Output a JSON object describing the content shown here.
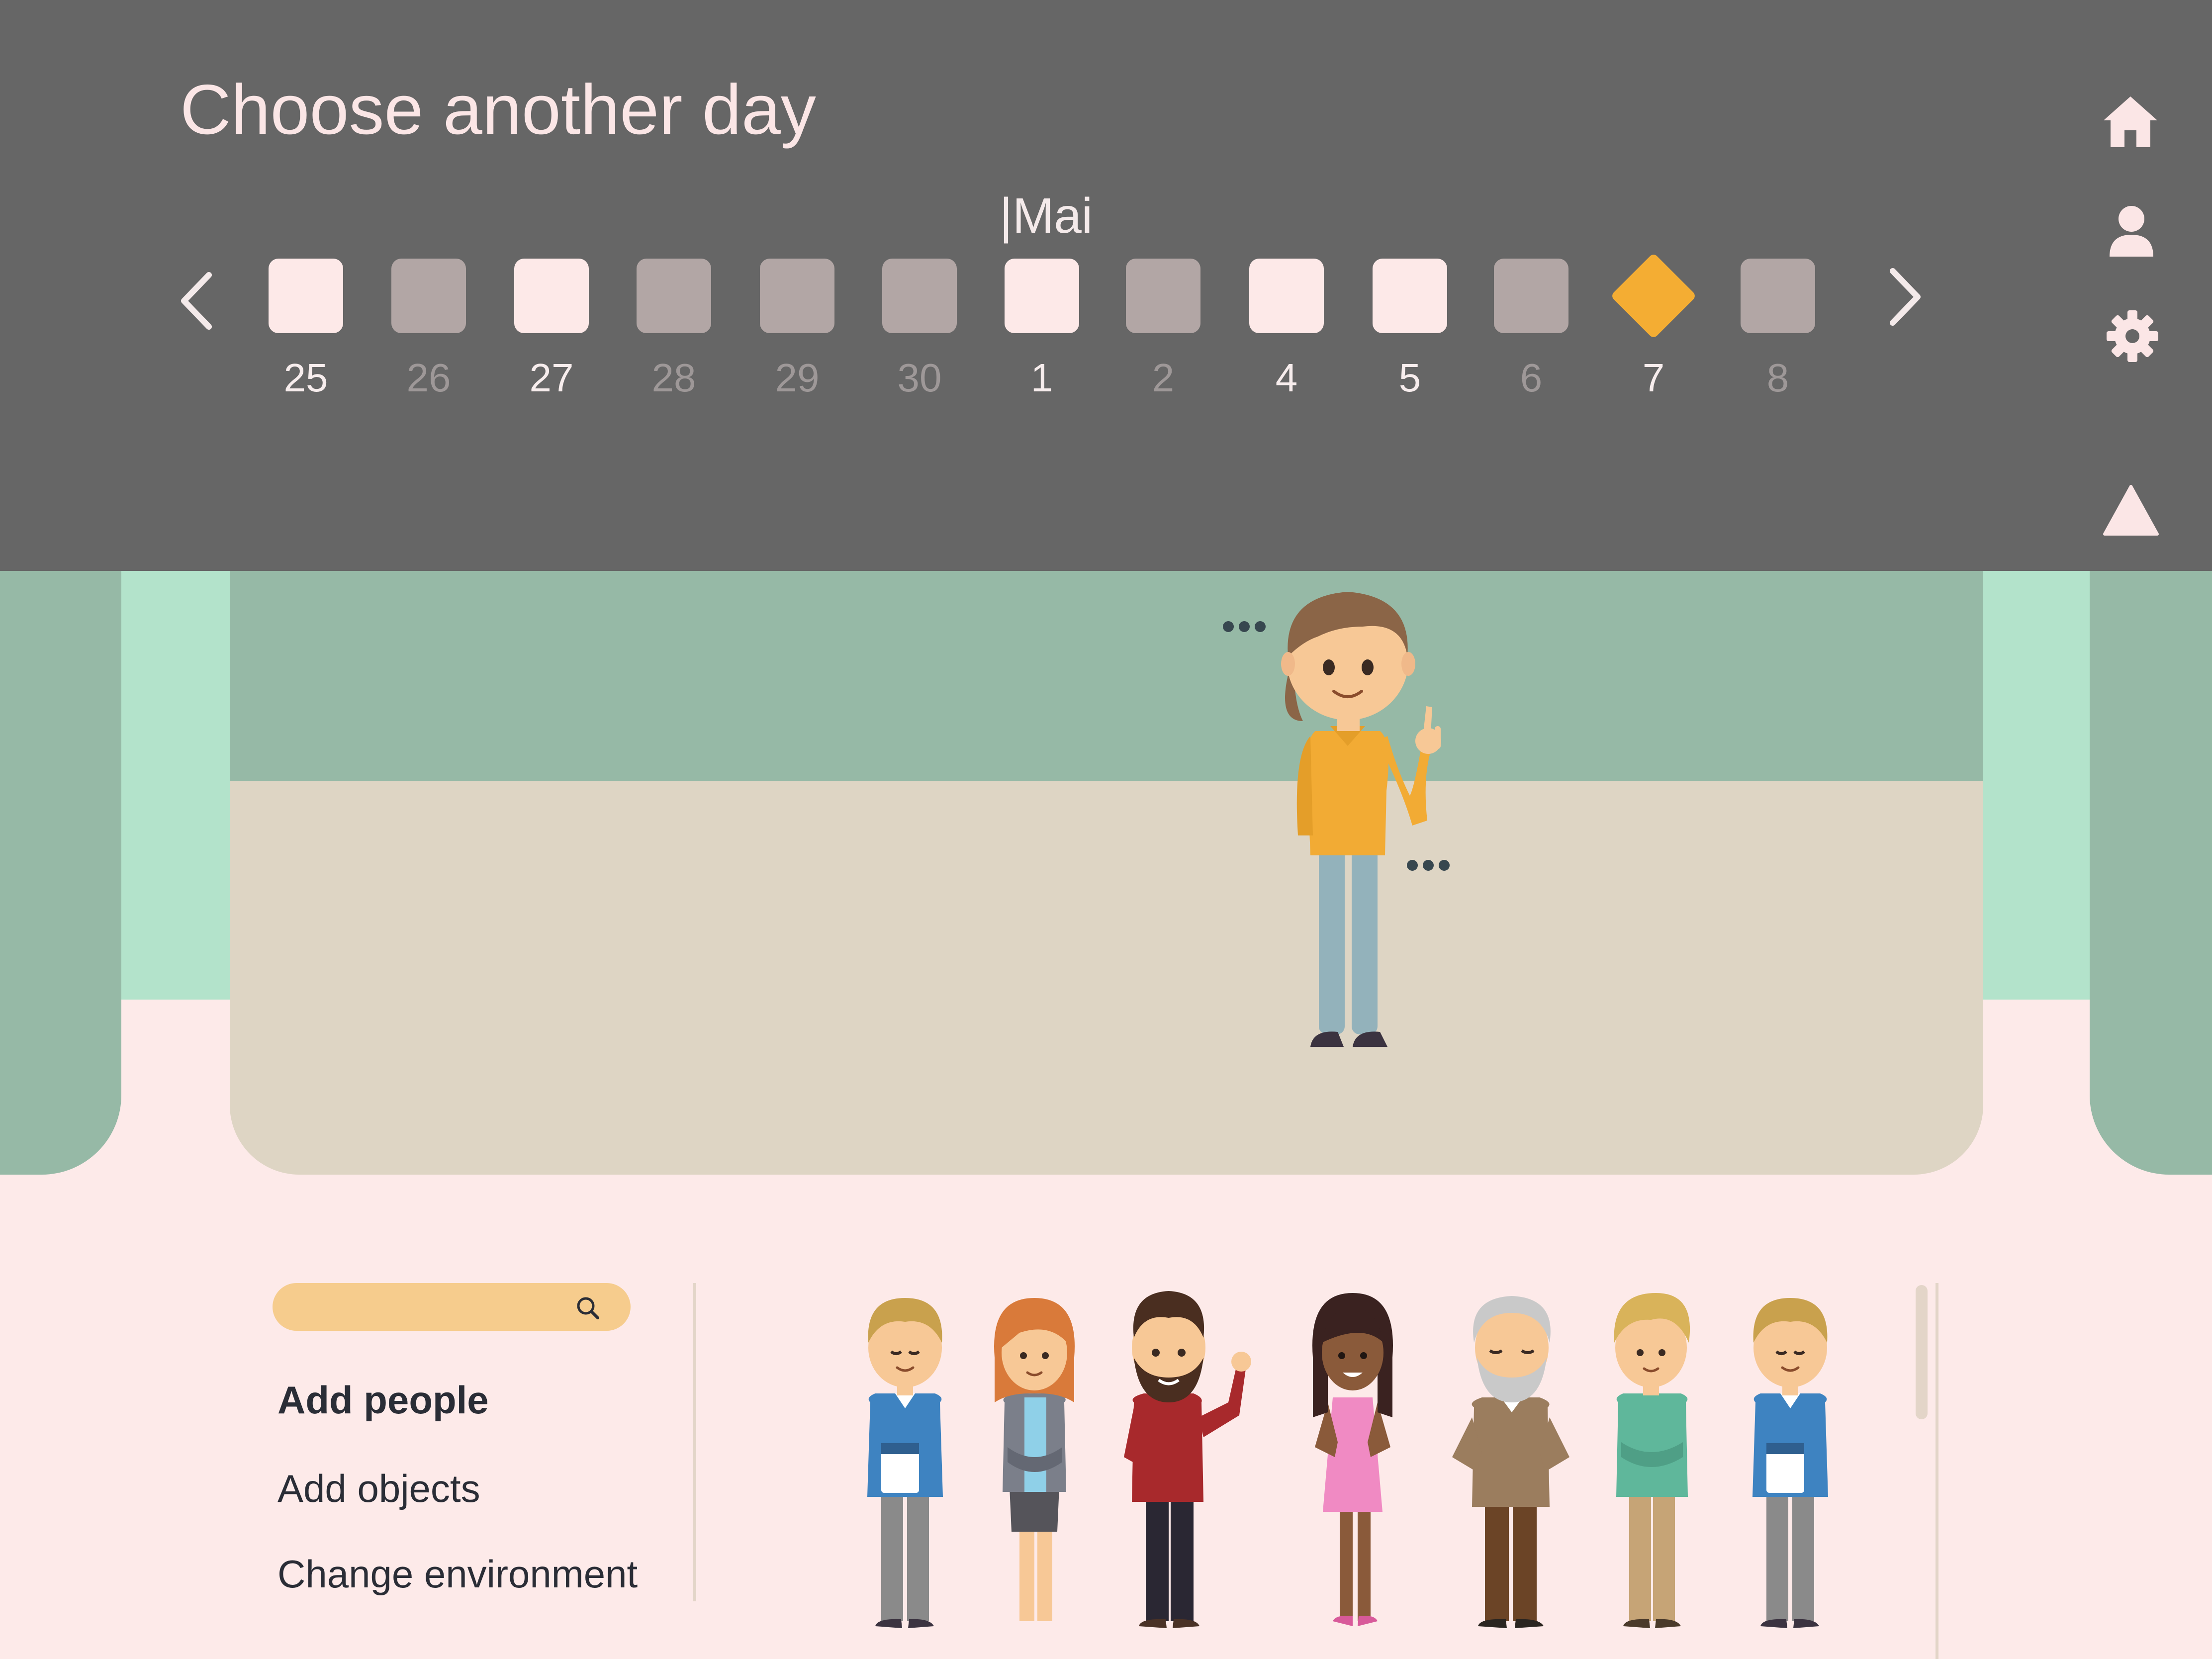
{
  "panel": {
    "title": "Choose another day",
    "month": "|Mai",
    "prev_icon": "chevron-left-icon",
    "next_icon": "chevron-right-icon",
    "days": [
      {
        "label": "25",
        "state": "available"
      },
      {
        "label": "26",
        "state": "unavailable"
      },
      {
        "label": "27",
        "state": "available"
      },
      {
        "label": "28",
        "state": "unavailable"
      },
      {
        "label": "29",
        "state": "unavailable"
      },
      {
        "label": "30",
        "state": "unavailable"
      },
      {
        "label": "1",
        "state": "available"
      },
      {
        "label": "2",
        "state": "unavailable"
      },
      {
        "label": "4",
        "state": "available"
      },
      {
        "label": "5",
        "state": "available"
      },
      {
        "label": "6",
        "state": "unavailable"
      },
      {
        "label": "7",
        "state": "selected"
      },
      {
        "label": "8",
        "state": "unavailable"
      }
    ],
    "colors": {
      "available": "#fde9e8",
      "unavailable": "#b2a6a5",
      "selected": "#f4ad33",
      "panel": "#666666"
    }
  },
  "side_icons": [
    "home-icon",
    "user-icon",
    "gear-icon",
    "collapse-triangle-icon"
  ],
  "search": {
    "placeholder": "",
    "value": "",
    "icon": "search-icon"
  },
  "menu": {
    "items": [
      {
        "label": "Add people",
        "active": true
      },
      {
        "label": "Add objects",
        "active": false
      },
      {
        "label": "Change environment",
        "active": false
      }
    ]
  },
  "people_list": [
    "blue-sweater-man",
    "red-haired-woman",
    "bearded-man",
    "woman-pink-dress",
    "elderly-man",
    "blond-man-teal-shirt",
    "man-blue-sweater"
  ]
}
